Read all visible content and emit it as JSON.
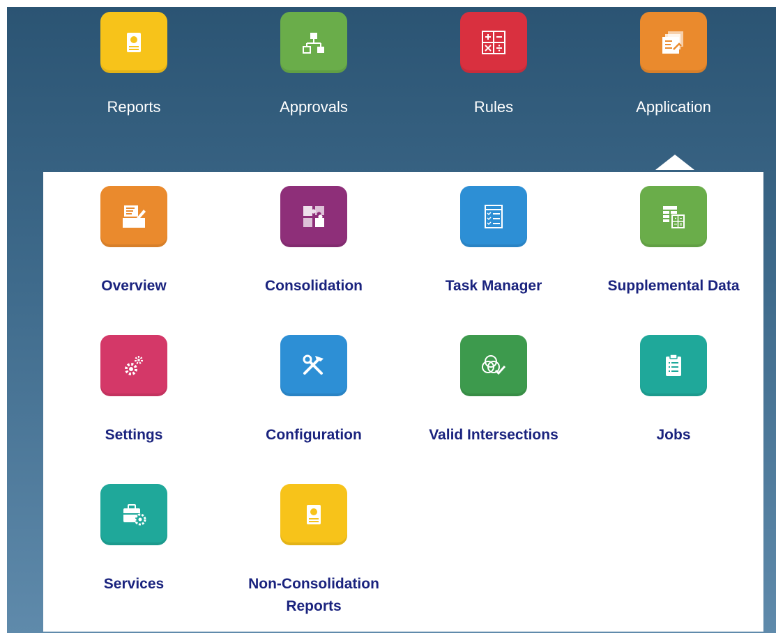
{
  "top_nav": [
    {
      "label": "Reports",
      "icon": "reports-icon",
      "color": "#f7c31a"
    },
    {
      "label": "Approvals",
      "icon": "approvals-icon",
      "color": "#6aad4a"
    },
    {
      "label": "Rules",
      "icon": "rules-icon",
      "color": "#d9303f"
    },
    {
      "label": "Application",
      "icon": "application-icon",
      "color": "#ea8a2d",
      "selected": true
    }
  ],
  "submenu": [
    {
      "label": "Overview",
      "icon": "overview-icon",
      "color": "#ea8a2d"
    },
    {
      "label": "Consolidation",
      "icon": "consolidation-icon",
      "color": "#8e2f79"
    },
    {
      "label": "Task Manager",
      "icon": "task-manager-icon",
      "color": "#2d8fd5"
    },
    {
      "label": "Supplemental Data",
      "icon": "supplemental-data-icon",
      "color": "#6aad4a"
    },
    {
      "label": "Settings",
      "icon": "settings-icon",
      "color": "#d43868"
    },
    {
      "label": "Configuration",
      "icon": "configuration-icon",
      "color": "#2d8fd5"
    },
    {
      "label": "Valid Intersections",
      "icon": "valid-intersections-icon",
      "color": "#3d9a4d"
    },
    {
      "label": "Jobs",
      "icon": "jobs-icon",
      "color": "#1fa89a"
    },
    {
      "label": "Services",
      "icon": "services-icon",
      "color": "#1fa89a"
    },
    {
      "label": "Non-Consolidation Reports",
      "icon": "non-consolidation-reports-icon",
      "color": "#f7c31a"
    }
  ]
}
